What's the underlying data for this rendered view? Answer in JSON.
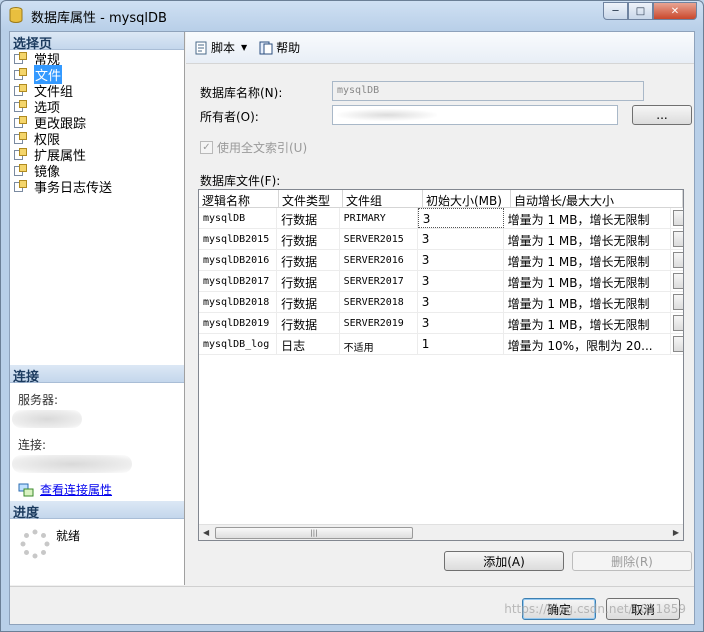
{
  "window": {
    "title": "数据库属性 - mysqlDB",
    "controls": {
      "minimize": "─",
      "maximize": "□",
      "close": "✕"
    }
  },
  "sidebar": {
    "select_page_title": "选择页",
    "pages": [
      {
        "label": "常规",
        "selected": false
      },
      {
        "label": "文件",
        "selected": true
      },
      {
        "label": "文件组",
        "selected": false
      },
      {
        "label": "选项",
        "selected": false
      },
      {
        "label": "更改跟踪",
        "selected": false
      },
      {
        "label": "权限",
        "selected": false
      },
      {
        "label": "扩展属性",
        "selected": false
      },
      {
        "label": "镜像",
        "selected": false
      },
      {
        "label": "事务日志传送",
        "selected": false
      }
    ],
    "connection_title": "连接",
    "server_label": "服务器:",
    "connection_label": "连接:",
    "view_connection_link": "查看连接属性",
    "progress_title": "进度",
    "progress_status": "就绪"
  },
  "toolbar": {
    "script_label": "脚本",
    "help_label": "帮助"
  },
  "form": {
    "db_name_label": "数据库名称(N):",
    "db_name_value": "mysqlDB",
    "owner_label": "所有者(O):",
    "owner_button": "...",
    "fulltext_label": "使用全文索引(U)",
    "fulltext_checked": true,
    "db_files_label": "数据库文件(F):"
  },
  "files_grid": {
    "columns": [
      "逻辑名称",
      "文件类型",
      "文件组",
      "初始大小(MB)",
      "自动增长/最大大小"
    ],
    "rows": [
      {
        "name": "mysqlDB",
        "type": "行数据",
        "filegroup": "PRIMARY",
        "size": "3",
        "growth": "增量为 1 MB，增长无限制"
      },
      {
        "name": "mysqlDB2015",
        "type": "行数据",
        "filegroup": "SERVER2015",
        "size": "3",
        "growth": "增量为 1 MB，增长无限制"
      },
      {
        "name": "mysqlDB2016",
        "type": "行数据",
        "filegroup": "SERVER2016",
        "size": "3",
        "growth": "增量为 1 MB，增长无限制"
      },
      {
        "name": "mysqlDB2017",
        "type": "行数据",
        "filegroup": "SERVER2017",
        "size": "3",
        "growth": "增量为 1 MB，增长无限制"
      },
      {
        "name": "mysqlDB2018",
        "type": "行数据",
        "filegroup": "SERVER2018",
        "size": "3",
        "growth": "增量为 1 MB，增长无限制"
      },
      {
        "name": "mysqlDB2019",
        "type": "行数据",
        "filegroup": "SERVER2019",
        "size": "3",
        "growth": "增量为 1 MB，增长无限制"
      },
      {
        "name": "mysqlDB_log",
        "type": "日志",
        "filegroup": "不适用",
        "size": "1",
        "growth": "增量为 10%，限制为 20..."
      }
    ],
    "cell_button": "..."
  },
  "actions": {
    "add_label": "添加(A)",
    "remove_label": "删除(R)"
  },
  "footer": {
    "ok_label": "确定",
    "cancel_label": "取消",
    "watermark": "https://blog.csdn.net/u011859"
  }
}
